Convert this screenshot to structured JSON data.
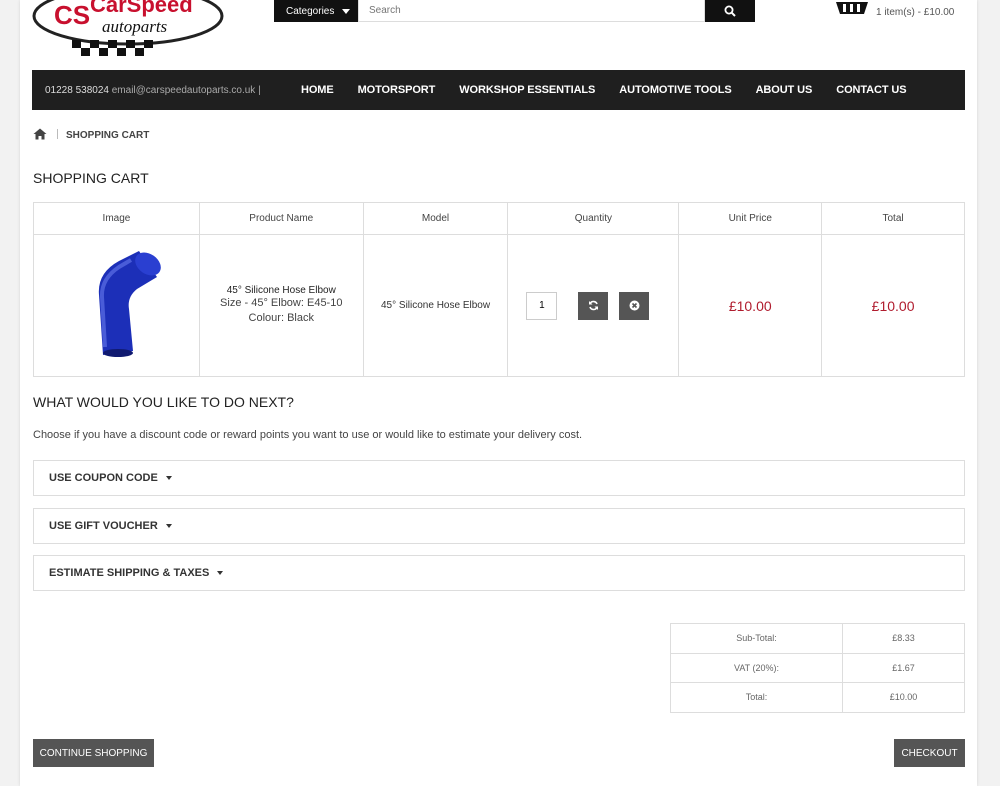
{
  "header": {
    "logo_text_top": "CarSpeed",
    "logo_text_bottom": "autoparts",
    "logo_monogram": "CS",
    "categories_label": "Categories",
    "search_placeholder": "Search",
    "cart_summary": "1 item(s) - £10.00"
  },
  "nav": {
    "phone": "01228 538024",
    "email": "email@carspeedautoparts.co.uk |",
    "items": [
      "HOME",
      "MOTORSPORT",
      "WORKSHOP ESSENTIALS",
      "AUTOMOTIVE TOOLS",
      "ABOUT US",
      "CONTACT US"
    ]
  },
  "breadcrumb": {
    "current": "SHOPPING CART"
  },
  "page_title": "SHOPPING CART",
  "table": {
    "headers": [
      "Image",
      "Product Name",
      "Model",
      "Quantity",
      "Unit Price",
      "Total"
    ],
    "rows": [
      {
        "name": "45° Silicone Hose Elbow",
        "option_size": "Size - 45° Elbow: E45-10",
        "option_colour": "Colour: Black",
        "model": "45° Silicone Hose Elbow",
        "quantity": "1",
        "unit_price": "£10.00",
        "total": "£10.00"
      }
    ]
  },
  "next": {
    "title": "WHAT WOULD YOU LIKE TO DO NEXT?",
    "description": "Choose if you have a discount code or reward points you want to use or would like to estimate your delivery cost.",
    "panels": [
      "USE COUPON CODE",
      "USE GIFT VOUCHER",
      "ESTIMATE SHIPPING & TAXES"
    ]
  },
  "totals": [
    {
      "label": "Sub-Total:",
      "value": "£8.33"
    },
    {
      "label": "VAT (20%):",
      "value": "£1.67"
    },
    {
      "label": "Total:",
      "value": "£10.00"
    }
  ],
  "buttons": {
    "continue": "CONTINUE SHOPPING",
    "checkout": "CHECKOUT"
  },
  "colors": {
    "nav_bg": "#1f1f1f",
    "price": "#b01c2e",
    "button": "#555555",
    "hose": "#1c2fb8"
  },
  "icons": [
    "search-icon",
    "cart-basket-icon",
    "home-icon",
    "refresh-icon",
    "remove-icon",
    "caret-down-icon"
  ]
}
